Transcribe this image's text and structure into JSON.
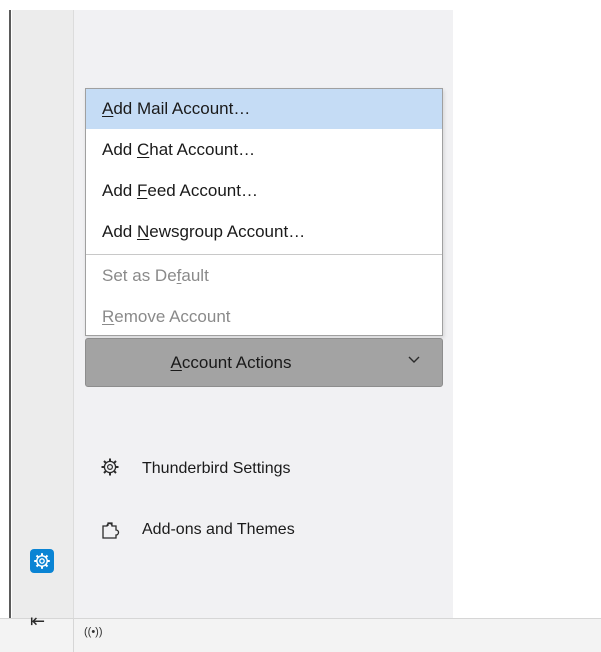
{
  "menu": {
    "items": [
      {
        "pre": "",
        "key": "A",
        "post": "dd Mail Account…"
      },
      {
        "pre": "Add ",
        "key": "C",
        "post": "hat Account…"
      },
      {
        "pre": "Add ",
        "key": "F",
        "post": "eed Account…"
      },
      {
        "pre": "Add ",
        "key": "N",
        "post": "ewsgroup Account…"
      },
      {
        "pre": "Set as De",
        "key": "f",
        "post": "ault"
      },
      {
        "pre": "",
        "key": "R",
        "post": "emove Account"
      }
    ]
  },
  "account_actions": {
    "pre": "",
    "key": "A",
    "post": "ccount Actions"
  },
  "links": {
    "settings": "Thunderbird Settings",
    "addons": "Add-ons and Themes"
  },
  "bottom_bar": {
    "collapse_glyph": "⇤",
    "activity_glyph": "((•))"
  },
  "colors": {
    "highlight": "#c5dcf5",
    "settings_space_button": "#0a84d4",
    "account_actions_button": "#a3a3a3"
  },
  "icons": {
    "settings_link": "gear-icon",
    "addons_link": "puzzle-icon",
    "settings_space": "gear-icon",
    "collapse": "collapse-arrow-icon",
    "activity": "activity-icon",
    "dropdown": "chevron-down-icon"
  }
}
